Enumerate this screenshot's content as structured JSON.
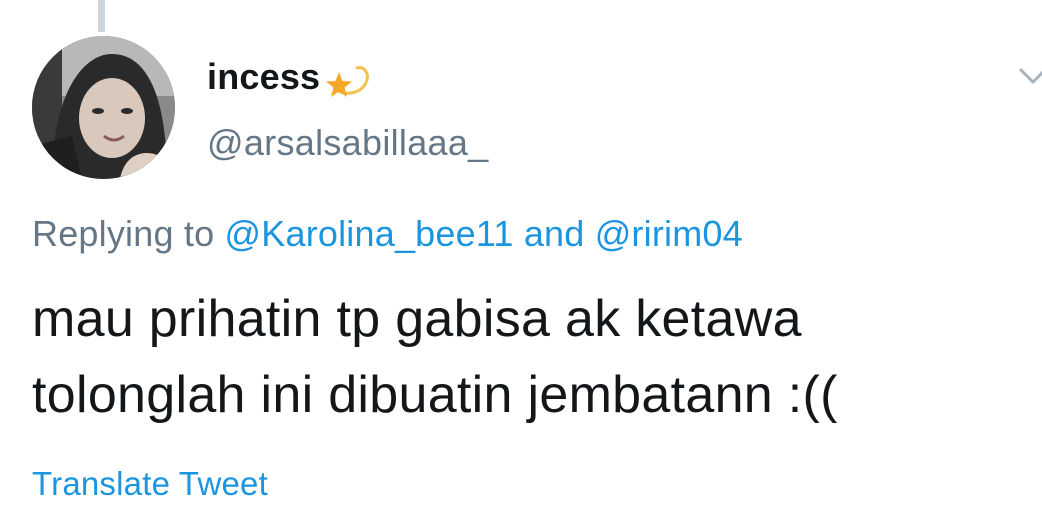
{
  "tweet": {
    "author": {
      "display_name": "incess",
      "badge_emoji": "shooting-star-emoji",
      "handle": "@arsalsabillaaa_",
      "avatar": "profile-photo"
    },
    "reply_context": {
      "prefix": "Replying to",
      "mention_1": "@Karolina_bee11",
      "conjunction": "and",
      "mention_2": "@ririm04"
    },
    "text_lines": [
      "mau prihatin tp gabisa ak ketawa",
      "tolonglah ini dibuatin jembatann :(("
    ],
    "translate_label": "Translate Tweet",
    "menu_icon": "chevron-down-icon"
  },
  "colors": {
    "primary_text": "#14171a",
    "secondary_text": "#657786",
    "link": "#1b95e0",
    "thread_line": "#ccd6dd"
  }
}
